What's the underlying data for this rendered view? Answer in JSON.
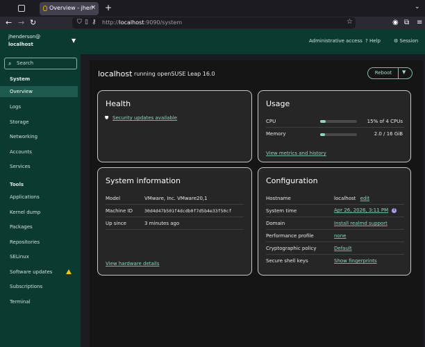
{
  "browser": {
    "tab_title": "Overview - jhenderson@",
    "tab_close": "×",
    "new_tab": "+",
    "tab_list": "⌄",
    "url_prefix": "http://",
    "url_host": "localhost",
    "url_rest": ":9090/system"
  },
  "masthead": {
    "user": "jhenderson@",
    "host": "localhost",
    "admin_access": "Administrative access",
    "help": "Help",
    "session": "Session"
  },
  "sidebar": {
    "search_placeholder": "Search",
    "system_header": "System",
    "system_items": [
      "Overview",
      "Logs",
      "Storage",
      "Networking",
      "Accounts",
      "Services"
    ],
    "tools_header": "Tools",
    "tools_items": [
      "Applications",
      "Kernel dump",
      "Packages",
      "Repositories",
      "SELinux",
      "Software updates",
      "Subscriptions",
      "Terminal"
    ]
  },
  "page": {
    "host": "localhost",
    "os": "running openSUSE Leap 16.0",
    "reboot": "Reboot"
  },
  "health": {
    "title": "Health",
    "security_link": "Security updates available"
  },
  "usage": {
    "title": "Usage",
    "cpu_label": "CPU",
    "cpu_value": "15% of 4 CPUs",
    "cpu_fraction": 0.15,
    "memory_label": "Memory",
    "memory_value": "2.0 / 16 GiB",
    "memory_fraction": 0.125,
    "metrics_link": "View metrics and history"
  },
  "sysinfo": {
    "title": "System information",
    "model_label": "Model",
    "model_value": "VMware, Inc. VMware20,1",
    "machine_label": "Machine ID",
    "machine_value": "30d4d47b501f4dcdb0f7d5b4e33f50cf",
    "up_label": "Up since",
    "up_value": "3 minutes ago",
    "hardware_link": "View hardware details"
  },
  "config": {
    "title": "Configuration",
    "hostname_label": "Hostname",
    "hostname_value": "localhost",
    "hostname_edit": "edit",
    "time_label": "System time",
    "time_value": "Apr 26, 2026, 3:11 PM",
    "domain_label": "Domain",
    "domain_value": "Install realmd support",
    "perf_label": "Performance profile",
    "perf_value": "none",
    "crypto_label": "Cryptographic policy",
    "crypto_value": "Default",
    "ssh_label": "Secure shell keys",
    "ssh_value": "Show fingerprints"
  },
  "colors": {
    "masthead_bg": "#0b3a30",
    "accent": "#8fd6c1",
    "warning": "#f0c419"
  }
}
